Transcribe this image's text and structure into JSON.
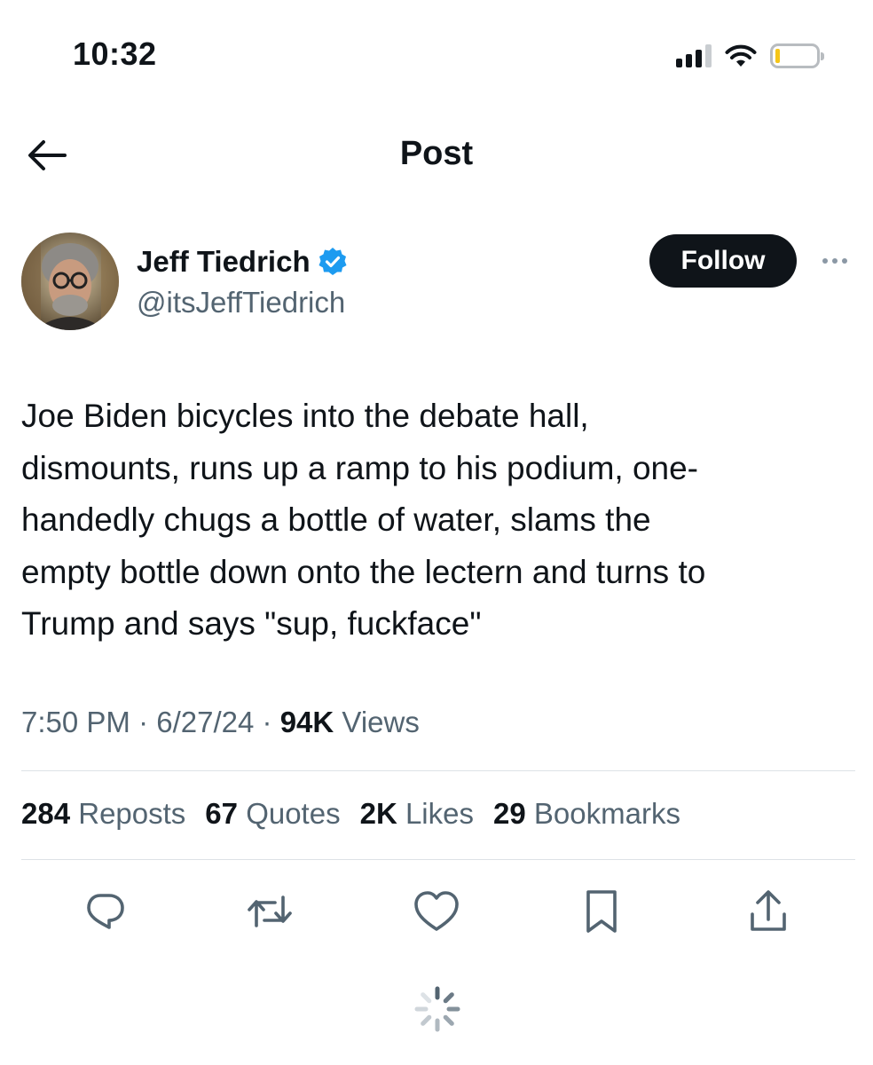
{
  "status_bar": {
    "time": "10:32",
    "icons": [
      "cellular-signal-icon",
      "wifi-icon",
      "battery-low-icon"
    ]
  },
  "header": {
    "back_icon": "arrow-left-icon",
    "title": "Post"
  },
  "author": {
    "name": "Jeff Tiedrich",
    "handle": "@itsJeffTiedrich",
    "verified": true,
    "verified_color": "#1d9bf0",
    "follow_label": "Follow",
    "more_icon": "ellipsis-icon"
  },
  "tweet": {
    "text": "Joe Biden bicycles into the debate hall, dismounts, runs up a ramp to his podium, one-handedly chugs a bottle of water, slams the empty bottle down onto the lectern and turns to Trump and says \"sup, fuckface\"",
    "lines": [
      "Joe Biden bicycles into the debate hall,",
      "dismounts, runs up a ramp to his podium, one-",
      "handedly chugs a bottle of water, slams the",
      "empty bottle down onto the lectern and turns to",
      "Trump and says \"sup, fuckface\""
    ],
    "time": "7:50 PM",
    "separator": "·",
    "date": "6/27/24",
    "views_count": "94K",
    "views_label": "Views"
  },
  "stats": [
    {
      "count": "284",
      "label": "Reposts"
    },
    {
      "count": "67",
      "label": "Quotes"
    },
    {
      "count": "2K",
      "label": "Likes"
    },
    {
      "count": "29",
      "label": "Bookmarks"
    }
  ],
  "actions": [
    "reply-icon",
    "repost-icon",
    "like-icon",
    "bookmark-icon",
    "share-icon"
  ],
  "colors": {
    "text_primary": "#0f1419",
    "text_secondary": "#536471",
    "divider": "#dde2e6",
    "follow_bg": "#0f1419",
    "battery_level": "#f5c518"
  }
}
